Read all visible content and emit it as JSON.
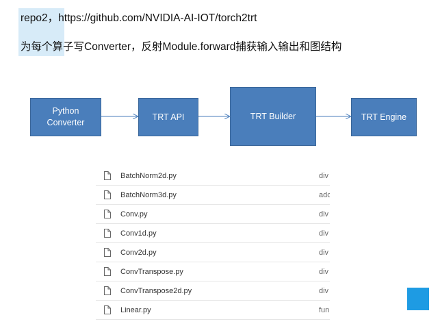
{
  "text": {
    "line1": "repo2，https://github.com/NVIDIA-AI-IOT/torch2trt",
    "line2": "为每个算子写Converter，反射Module.forward捕获输入输出和图结构"
  },
  "diagram": {
    "box_python_line1": "Python",
    "box_python_line2": "Converter",
    "box_trtapi": "TRT API",
    "box_builder": "TRT Builder",
    "box_engine": "TRT Engine",
    "box_color": "#4a7ebb",
    "arrow_color": "#4a7ebb"
  },
  "files": [
    {
      "name": "BatchNorm2d.py",
      "msg": "div"
    },
    {
      "name": "BatchNorm3d.py",
      "msg": "adc"
    },
    {
      "name": "Conv.py",
      "msg": "div"
    },
    {
      "name": "Conv1d.py",
      "msg": "div"
    },
    {
      "name": "Conv2d.py",
      "msg": "div"
    },
    {
      "name": "ConvTranspose.py",
      "msg": "div"
    },
    {
      "name": "ConvTranspose2d.py",
      "msg": "div"
    },
    {
      "name": "Linear.py",
      "msg": "fun"
    }
  ],
  "accent": "#1e9be3",
  "icons": {
    "file": "file-icon"
  }
}
